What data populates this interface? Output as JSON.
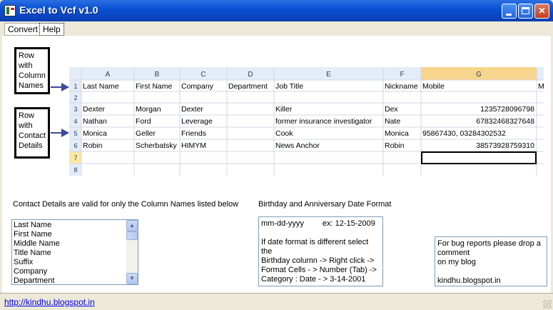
{
  "window": {
    "title": "Excel to Vcf v1.0",
    "controls": {
      "minimize": "",
      "maximize": "",
      "close": "✕"
    }
  },
  "menu": {
    "items": [
      "Convert",
      "Help"
    ]
  },
  "annotations": {
    "row_with_column_names": [
      "Row",
      "with",
      "Column",
      "Names"
    ],
    "row_with_contact_details": [
      "Row",
      "with",
      "Contact",
      "Details"
    ]
  },
  "excel_preview": {
    "column_letters": [
      "A",
      "B",
      "C",
      "D",
      "E",
      "F",
      "G"
    ],
    "row_numbers": [
      "1",
      "2",
      "3",
      "4",
      "5",
      "6",
      "7",
      "8"
    ],
    "headers": [
      "Last Name",
      "First Name",
      "Company",
      "Department",
      "Job Title",
      "Nickname",
      "Mobile",
      "M"
    ],
    "rows": [
      [
        "",
        "",
        "",
        "",
        "",
        "",
        ""
      ],
      [
        "Dexter",
        "Morgan",
        "Dexter",
        "",
        "Killer",
        "Dex",
        "1235728096798"
      ],
      [
        "Nathan",
        "Ford",
        "Leverage",
        "",
        "former insurance investigator",
        "Nate",
        "67832468327648"
      ],
      [
        "Monica",
        "Geller",
        "Friends",
        "",
        "Cook",
        "Monica",
        "95867430, 03284302532"
      ],
      [
        "Robin",
        "Scherbatsky",
        "HIMYM",
        "",
        "News Anchor",
        "Robin",
        "38573928759310"
      ],
      [
        "",
        "",
        "",
        "",
        "",
        "",
        ""
      ]
    ]
  },
  "contact_section": {
    "label": "Contact Details are valid for only the Column Names listed below",
    "fields": [
      "Last Name",
      "First Name",
      "Middle Name",
      "Title Name",
      "Suffix",
      "Company",
      "Department"
    ]
  },
  "date_section": {
    "label": "Birthday and Anniversary Date Format",
    "format": "mm-dd-yyyy",
    "example": "ex: 12-15-2009",
    "instructions": [
      "If date format is different select the",
      "Birthday column -> Right click ->",
      "Format Cells - > Number (Tab) ->",
      "Category : Date - > 3-14-2001"
    ]
  },
  "bug_section": {
    "lines": [
      "For bug reports please drop a",
      "comment",
      "on my blog",
      "",
      "kindhu.blogspot.in"
    ]
  },
  "status": {
    "link": "http://kindhu.blogspot.in"
  },
  "colors": {
    "title_bar": "#0a52d6",
    "window_bg": "#ece9d8",
    "selected_col": "#f7d58c",
    "active_row": "#fde7a6",
    "link": "#0000ee"
  }
}
